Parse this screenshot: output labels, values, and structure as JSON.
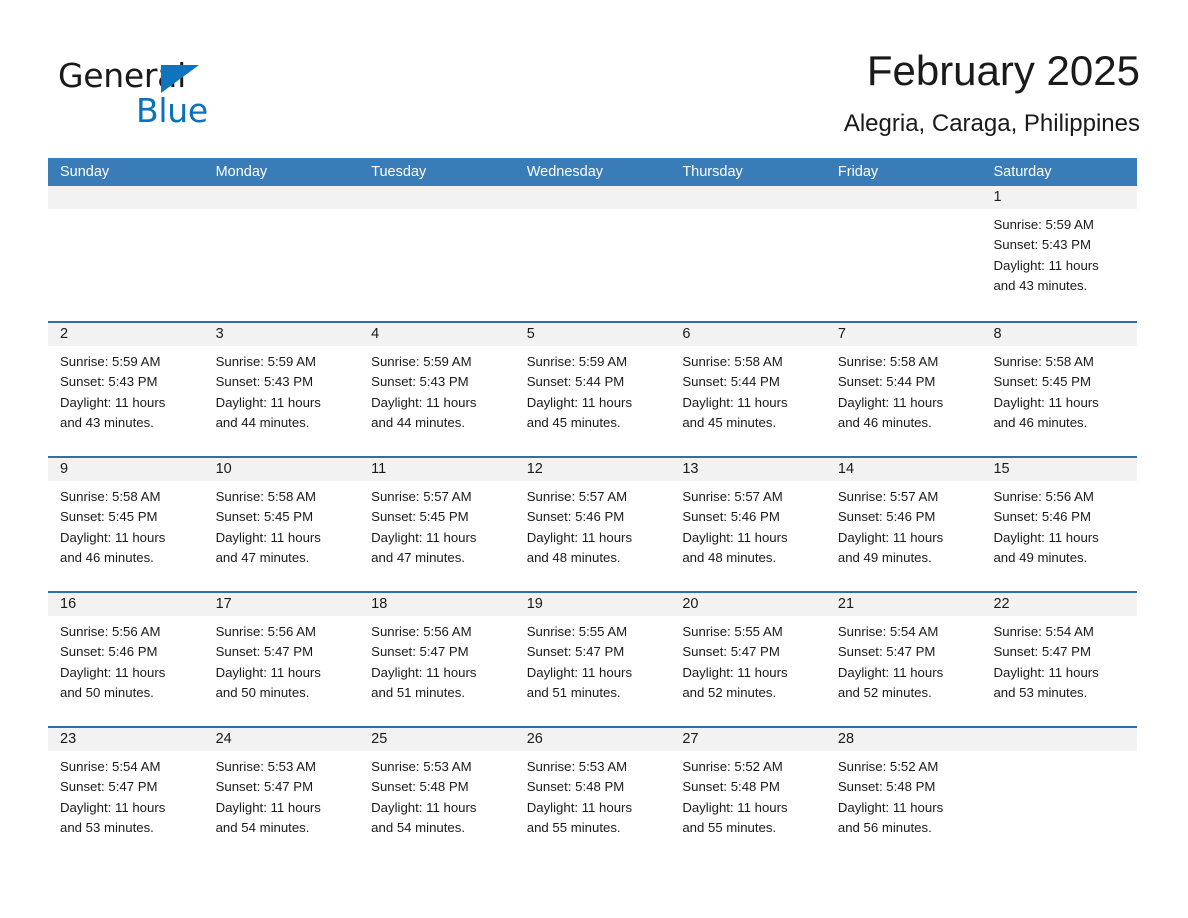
{
  "brand": {
    "name_part1": "General",
    "name_part2": "Blue",
    "accent_color": "#0a72bd",
    "triangle_icon": "triangle-icon"
  },
  "header": {
    "title": "February 2025",
    "subtitle": "Alegria, Caraga, Philippines"
  },
  "theme": {
    "header_row_bg": "#3a7cb8",
    "week_divider": "#2f6fa8",
    "day_number_bg": "#f2f2f2"
  },
  "weekdays": [
    "Sunday",
    "Monday",
    "Tuesday",
    "Wednesday",
    "Thursday",
    "Friday",
    "Saturday"
  ],
  "labels": {
    "sunrise": "Sunrise:",
    "sunset": "Sunset:",
    "daylight": "Daylight:"
  },
  "weeks": [
    {
      "days": [
        {
          "day": "",
          "empty": true
        },
        {
          "day": "",
          "empty": true
        },
        {
          "day": "",
          "empty": true
        },
        {
          "day": "",
          "empty": true
        },
        {
          "day": "",
          "empty": true
        },
        {
          "day": "",
          "empty": true
        },
        {
          "day": "1",
          "sunrise": "Sunrise: 5:59 AM",
          "sunset": "Sunset: 5:43 PM",
          "daylight_line1": "Daylight: 11 hours",
          "daylight_line2": "and 43 minutes."
        }
      ]
    },
    {
      "days": [
        {
          "day": "2",
          "sunrise": "Sunrise: 5:59 AM",
          "sunset": "Sunset: 5:43 PM",
          "daylight_line1": "Daylight: 11 hours",
          "daylight_line2": "and 43 minutes."
        },
        {
          "day": "3",
          "sunrise": "Sunrise: 5:59 AM",
          "sunset": "Sunset: 5:43 PM",
          "daylight_line1": "Daylight: 11 hours",
          "daylight_line2": "and 44 minutes."
        },
        {
          "day": "4",
          "sunrise": "Sunrise: 5:59 AM",
          "sunset": "Sunset: 5:43 PM",
          "daylight_line1": "Daylight: 11 hours",
          "daylight_line2": "and 44 minutes."
        },
        {
          "day": "5",
          "sunrise": "Sunrise: 5:59 AM",
          "sunset": "Sunset: 5:44 PM",
          "daylight_line1": "Daylight: 11 hours",
          "daylight_line2": "and 45 minutes."
        },
        {
          "day": "6",
          "sunrise": "Sunrise: 5:58 AM",
          "sunset": "Sunset: 5:44 PM",
          "daylight_line1": "Daylight: 11 hours",
          "daylight_line2": "and 45 minutes."
        },
        {
          "day": "7",
          "sunrise": "Sunrise: 5:58 AM",
          "sunset": "Sunset: 5:44 PM",
          "daylight_line1": "Daylight: 11 hours",
          "daylight_line2": "and 46 minutes."
        },
        {
          "day": "8",
          "sunrise": "Sunrise: 5:58 AM",
          "sunset": "Sunset: 5:45 PM",
          "daylight_line1": "Daylight: 11 hours",
          "daylight_line2": "and 46 minutes."
        }
      ]
    },
    {
      "days": [
        {
          "day": "9",
          "sunrise": "Sunrise: 5:58 AM",
          "sunset": "Sunset: 5:45 PM",
          "daylight_line1": "Daylight: 11 hours",
          "daylight_line2": "and 46 minutes."
        },
        {
          "day": "10",
          "sunrise": "Sunrise: 5:58 AM",
          "sunset": "Sunset: 5:45 PM",
          "daylight_line1": "Daylight: 11 hours",
          "daylight_line2": "and 47 minutes."
        },
        {
          "day": "11",
          "sunrise": "Sunrise: 5:57 AM",
          "sunset": "Sunset: 5:45 PM",
          "daylight_line1": "Daylight: 11 hours",
          "daylight_line2": "and 47 minutes."
        },
        {
          "day": "12",
          "sunrise": "Sunrise: 5:57 AM",
          "sunset": "Sunset: 5:46 PM",
          "daylight_line1": "Daylight: 11 hours",
          "daylight_line2": "and 48 minutes."
        },
        {
          "day": "13",
          "sunrise": "Sunrise: 5:57 AM",
          "sunset": "Sunset: 5:46 PM",
          "daylight_line1": "Daylight: 11 hours",
          "daylight_line2": "and 48 minutes."
        },
        {
          "day": "14",
          "sunrise": "Sunrise: 5:57 AM",
          "sunset": "Sunset: 5:46 PM",
          "daylight_line1": "Daylight: 11 hours",
          "daylight_line2": "and 49 minutes."
        },
        {
          "day": "15",
          "sunrise": "Sunrise: 5:56 AM",
          "sunset": "Sunset: 5:46 PM",
          "daylight_line1": "Daylight: 11 hours",
          "daylight_line2": "and 49 minutes."
        }
      ]
    },
    {
      "days": [
        {
          "day": "16",
          "sunrise": "Sunrise: 5:56 AM",
          "sunset": "Sunset: 5:46 PM",
          "daylight_line1": "Daylight: 11 hours",
          "daylight_line2": "and 50 minutes."
        },
        {
          "day": "17",
          "sunrise": "Sunrise: 5:56 AM",
          "sunset": "Sunset: 5:47 PM",
          "daylight_line1": "Daylight: 11 hours",
          "daylight_line2": "and 50 minutes."
        },
        {
          "day": "18",
          "sunrise": "Sunrise: 5:56 AM",
          "sunset": "Sunset: 5:47 PM",
          "daylight_line1": "Daylight: 11 hours",
          "daylight_line2": "and 51 minutes."
        },
        {
          "day": "19",
          "sunrise": "Sunrise: 5:55 AM",
          "sunset": "Sunset: 5:47 PM",
          "daylight_line1": "Daylight: 11 hours",
          "daylight_line2": "and 51 minutes."
        },
        {
          "day": "20",
          "sunrise": "Sunrise: 5:55 AM",
          "sunset": "Sunset: 5:47 PM",
          "daylight_line1": "Daylight: 11 hours",
          "daylight_line2": "and 52 minutes."
        },
        {
          "day": "21",
          "sunrise": "Sunrise: 5:54 AM",
          "sunset": "Sunset: 5:47 PM",
          "daylight_line1": "Daylight: 11 hours",
          "daylight_line2": "and 52 minutes."
        },
        {
          "day": "22",
          "sunrise": "Sunrise: 5:54 AM",
          "sunset": "Sunset: 5:47 PM",
          "daylight_line1": "Daylight: 11 hours",
          "daylight_line2": "and 53 minutes."
        }
      ]
    },
    {
      "days": [
        {
          "day": "23",
          "sunrise": "Sunrise: 5:54 AM",
          "sunset": "Sunset: 5:47 PM",
          "daylight_line1": "Daylight: 11 hours",
          "daylight_line2": "and 53 minutes."
        },
        {
          "day": "24",
          "sunrise": "Sunrise: 5:53 AM",
          "sunset": "Sunset: 5:47 PM",
          "daylight_line1": "Daylight: 11 hours",
          "daylight_line2": "and 54 minutes."
        },
        {
          "day": "25",
          "sunrise": "Sunrise: 5:53 AM",
          "sunset": "Sunset: 5:48 PM",
          "daylight_line1": "Daylight: 11 hours",
          "daylight_line2": "and 54 minutes."
        },
        {
          "day": "26",
          "sunrise": "Sunrise: 5:53 AM",
          "sunset": "Sunset: 5:48 PM",
          "daylight_line1": "Daylight: 11 hours",
          "daylight_line2": "and 55 minutes."
        },
        {
          "day": "27",
          "sunrise": "Sunrise: 5:52 AM",
          "sunset": "Sunset: 5:48 PM",
          "daylight_line1": "Daylight: 11 hours",
          "daylight_line2": "and 55 minutes."
        },
        {
          "day": "28",
          "sunrise": "Sunrise: 5:52 AM",
          "sunset": "Sunset: 5:48 PM",
          "daylight_line1": "Daylight: 11 hours",
          "daylight_line2": "and 56 minutes."
        },
        {
          "day": "",
          "empty": true
        }
      ]
    }
  ]
}
